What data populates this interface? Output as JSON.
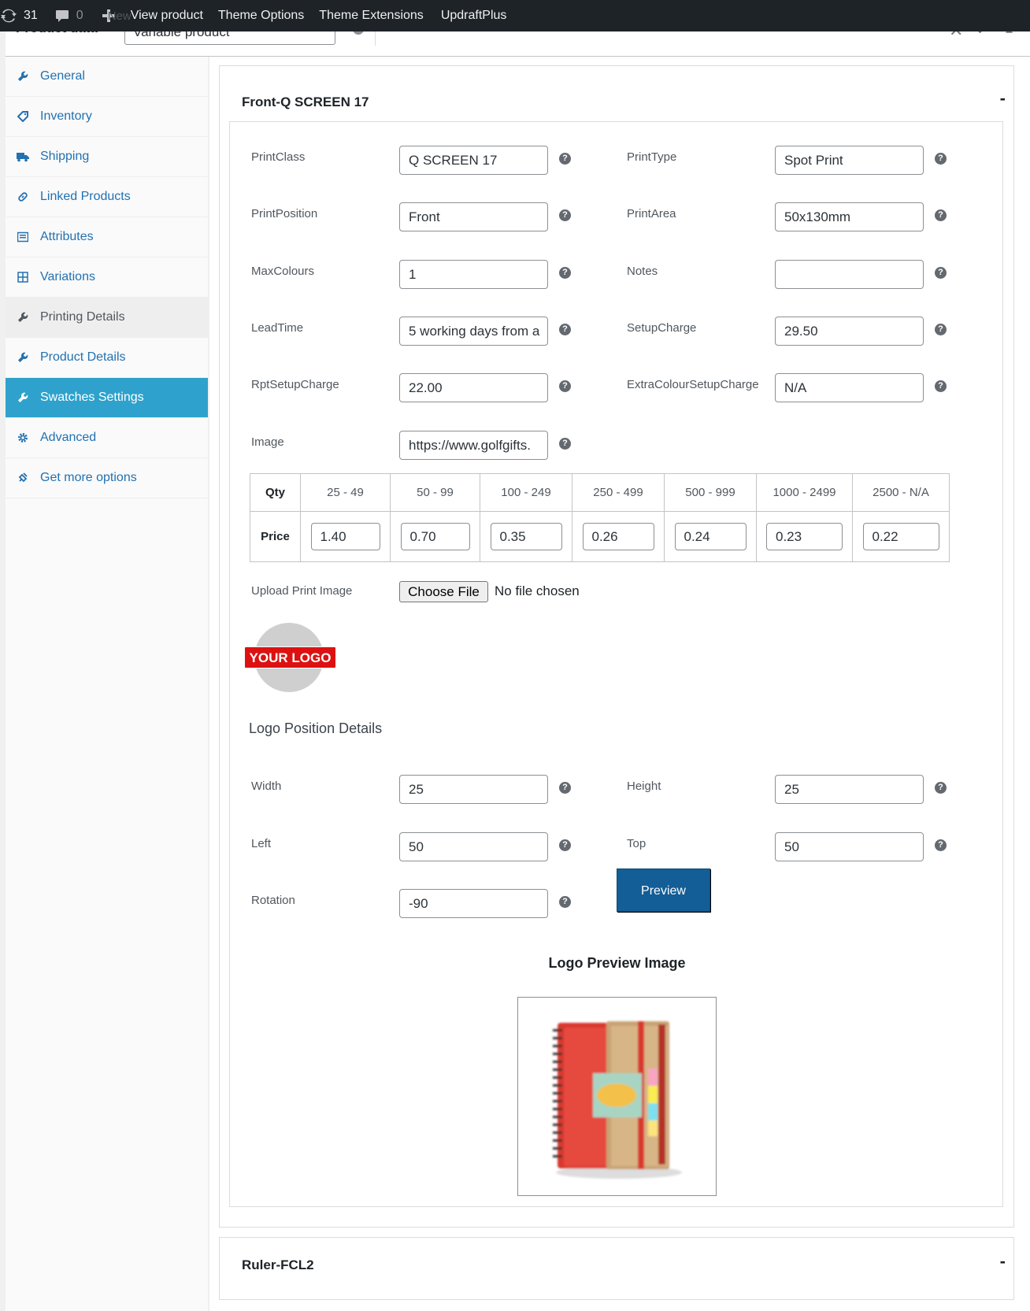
{
  "adminbar": {
    "updates_count": "31",
    "comments_count": "0",
    "new_label": "New",
    "view_product": "View product",
    "theme_options": "Theme Options",
    "theme_extensions": "Theme Extensions",
    "updraftplus": "UpdraftPlus"
  },
  "header": {
    "title": "Product data",
    "product_type": "Variable product"
  },
  "sidebar": {
    "items": [
      {
        "label": "General",
        "icon": "wrench-icon"
      },
      {
        "label": "Inventory",
        "icon": "tag-icon"
      },
      {
        "label": "Shipping",
        "icon": "truck-icon"
      },
      {
        "label": "Linked Products",
        "icon": "link-icon"
      },
      {
        "label": "Attributes",
        "icon": "list-icon"
      },
      {
        "label": "Variations",
        "icon": "grid-icon"
      },
      {
        "label": "Printing Details",
        "icon": "wrench-icon"
      },
      {
        "label": "Product Details",
        "icon": "wrench-icon"
      },
      {
        "label": "Swatches Settings",
        "icon": "wrench-icon"
      },
      {
        "label": "Advanced",
        "icon": "gear-icon"
      },
      {
        "label": "Get more options",
        "icon": "plugin-icon"
      }
    ]
  },
  "print_block": {
    "title": "Front-Q SCREEN 17",
    "toggle": "-",
    "fields": {
      "print_class": {
        "label": "PrintClass",
        "value": "Q SCREEN 17"
      },
      "print_type": {
        "label": "PrintType",
        "value": "Spot Print"
      },
      "print_position": {
        "label": "PrintPosition",
        "value": "Front"
      },
      "print_area": {
        "label": "PrintArea",
        "value": "50x130mm"
      },
      "max_colours": {
        "label": "MaxColours",
        "value": "1"
      },
      "notes": {
        "label": "Notes",
        "value": ""
      },
      "lead_time": {
        "label": "LeadTime",
        "value": "5 working days from a"
      },
      "setup_charge": {
        "label": "SetupCharge",
        "value": "29.50"
      },
      "rpt_setup_charge": {
        "label": "RptSetupCharge",
        "value": "22.00"
      },
      "extra_colour_setup_charge": {
        "label": "ExtraColourSetupCharge",
        "value": "N/A"
      },
      "image": {
        "label": "Image",
        "value": "https://www.golfgifts."
      }
    },
    "price_table": {
      "qty_label": "Qty",
      "price_label": "Price",
      "ranges": [
        "25 - 49",
        "50 - 99",
        "100 - 249",
        "250 - 499",
        "500 - 999",
        "1000 - 2499",
        "2500 - N/A"
      ],
      "prices": [
        "1.40",
        "0.70",
        "0.35",
        "0.26",
        "0.24",
        "0.23",
        "0.22"
      ]
    },
    "upload": {
      "label": "Upload Print Image",
      "button": "Choose File",
      "status": "No file chosen"
    },
    "logo_text": "YOUR LOGO",
    "logo_position": {
      "heading": "Logo Position Details",
      "width": {
        "label": "Width",
        "value": "25"
      },
      "height": {
        "label": "Height",
        "value": "25"
      },
      "left": {
        "label": "Left",
        "value": "50"
      },
      "top": {
        "label": "Top",
        "value": "50"
      },
      "rotation": {
        "label": "Rotation",
        "value": "-90"
      },
      "preview_button": "Preview"
    },
    "preview_title": "Logo Preview Image",
    "help_glyph": "?"
  },
  "second_block": {
    "title": "Ruler-FCL2",
    "toggle": "-"
  },
  "colors": {
    "admin_bar": "#1d2327",
    "link": "#2271b1",
    "active_tab": "#2ea2cc",
    "preview_button": "#135e96",
    "logo_red": "#dd1111"
  }
}
